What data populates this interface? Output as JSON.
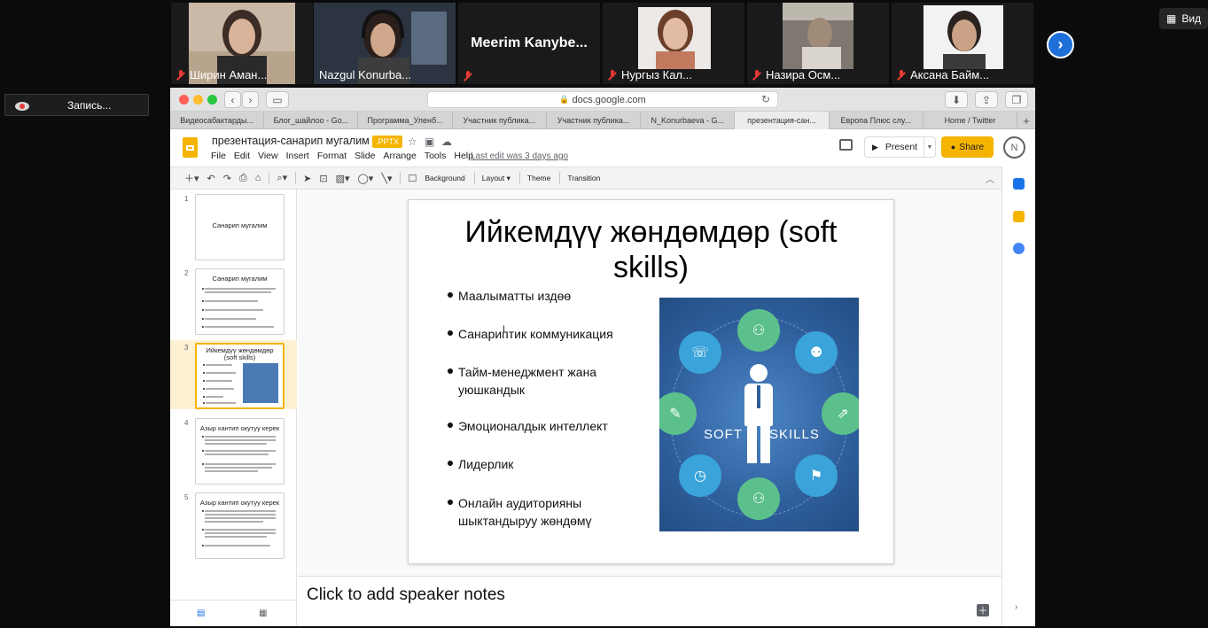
{
  "zoom": {
    "participants": [
      {
        "name": "Ширин Аман...",
        "muted": true
      },
      {
        "name": "Nazgul Konurba...",
        "muted": false
      },
      {
        "name": "Meerim  Kanybe...",
        "muted": true
      },
      {
        "name": "Нургыз Кал...",
        "muted": true
      },
      {
        "name": "Назира Осм...",
        "muted": true
      },
      {
        "name": "Аксана Байм...",
        "muted": true
      }
    ],
    "view_label": "Вид",
    "record_label": "Запись..."
  },
  "browser": {
    "url": "docs.google.com",
    "tabs": [
      "Видеосабактарды...",
      "Блог_шайлоо - Go...",
      "Программа_Уленб...",
      "Участник публика...",
      "Участник публика...",
      "N_Konurbaeva - G...",
      "презентация-сан...",
      "Европа Плюс слу...",
      "Home / Twitter"
    ],
    "active_tab_index": 6
  },
  "slides_app": {
    "doc_title": "презентация-санарип мугалим",
    "badge": ".PPTX",
    "menu": [
      "File",
      "Edit",
      "View",
      "Insert",
      "Format",
      "Slide",
      "Arrange",
      "Tools",
      "Help"
    ],
    "last_edit": "Last edit was 3 days ago",
    "present_label": "Present",
    "share_label": "Share",
    "avatar_letter": "N",
    "toolbar": {
      "background": "Background",
      "layout": "Layout",
      "theme": "Theme",
      "transition": "Transition"
    },
    "accent_color": "#f4b400"
  },
  "filmstrip": {
    "slides": [
      {
        "num": "1",
        "title": "Санарип мугалим"
      },
      {
        "num": "2",
        "title": "Санарип мугалим"
      },
      {
        "num": "3",
        "title": "Ийкемдүү жөндөмдөр (soft skills)"
      },
      {
        "num": "4",
        "title": "Азыр кантип окутуу керек"
      },
      {
        "num": "5",
        "title": "Азыр кантип окутуу керек"
      }
    ],
    "active_index": 2
  },
  "slide": {
    "title": "Ийкемдүү жөндөмдөр (soft skills)",
    "bullets": [
      "Маалыматты издөө",
      "Санариптик коммуникация",
      "Тайм-менеджмент жана уюшкандык",
      "Эмоционалдык интеллект",
      "Лидерлик",
      "Онлайн аудиторияны шыктандыруу жөндөмү"
    ],
    "image_soft": "SOFT",
    "image_skills": "SKILLS"
  },
  "notes": {
    "placeholder": "Click to add speaker notes"
  }
}
